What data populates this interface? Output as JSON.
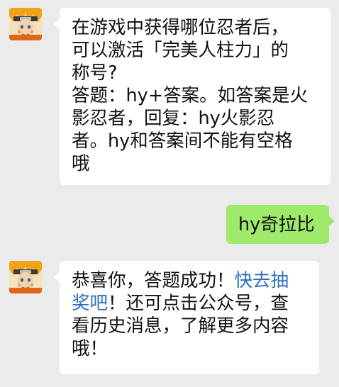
{
  "chat": {
    "messages": [
      {
        "sender": "official-account",
        "avatar_icon": "naruto-avatar-icon",
        "lines": [
          "在游戏中获得哪位忍者后，",
          "可以激活「完美人柱力」的",
          "称号?",
          "答题：hy+答案。如答案是火",
          "影忍者，回复：hy火影忍",
          "者。hy和答案间不能有空格",
          "哦"
        ]
      },
      {
        "sender": "me",
        "text": "hy奇拉比"
      },
      {
        "sender": "official-account",
        "avatar_icon": "naruto-avatar-icon",
        "line1_prefix": "恭喜你，答题成功！",
        "line1_link": "快去抽",
        "line2_link": "奖吧",
        "line2_rest": "！还可点击公众号，查",
        "line3": "看历史消息，了解更多内容",
        "line4": "哦！"
      }
    ]
  },
  "colors": {
    "background": "#ebebeb",
    "incoming_bubble": "#ffffff",
    "outgoing_bubble": "#9eea6a",
    "link": "#2b6fc2"
  }
}
